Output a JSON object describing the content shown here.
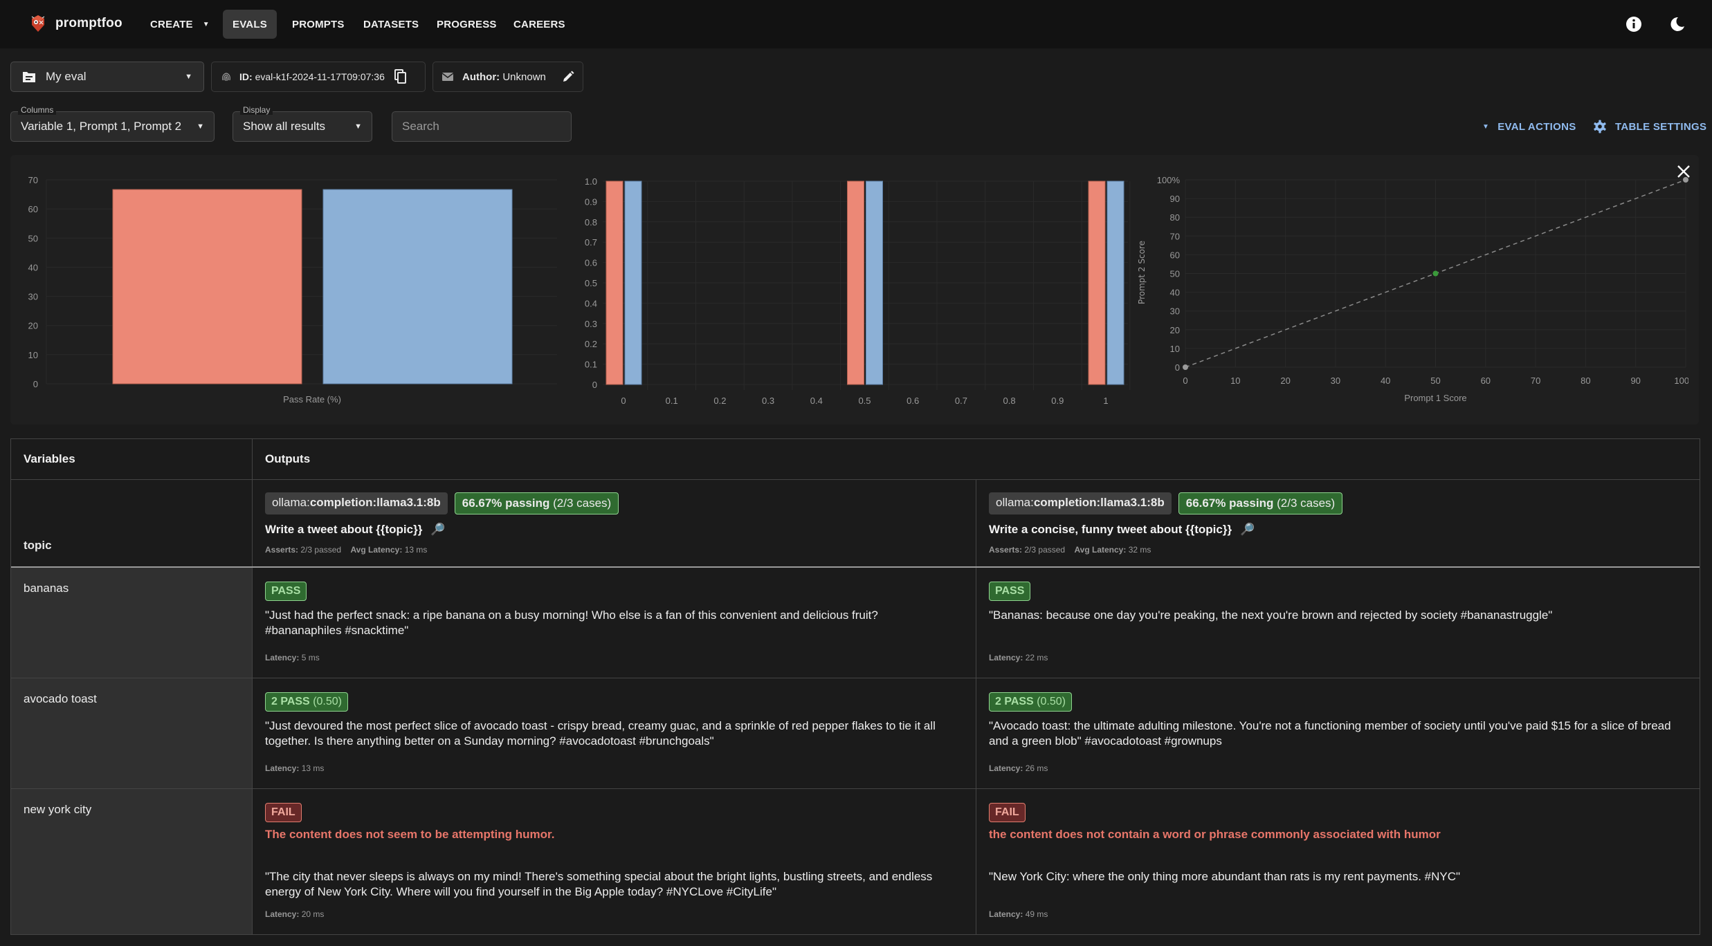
{
  "nav": {
    "brand": "promptfoo",
    "items": [
      {
        "label": "CREATE",
        "has_dropdown": true,
        "active": false
      },
      {
        "label": "EVALS",
        "has_dropdown": false,
        "active": true
      },
      {
        "label": "PROMPTS",
        "has_dropdown": false,
        "active": false
      },
      {
        "label": "DATASETS",
        "has_dropdown": false,
        "active": false
      },
      {
        "label": "PROGRESS",
        "has_dropdown": false,
        "active": false
      },
      {
        "label": "CAREERS",
        "has_dropdown": false,
        "active": false
      }
    ],
    "right_icons": [
      "info-icon",
      "moon-icon"
    ]
  },
  "toolbar": {
    "eval_name": "My eval",
    "id_label": "ID:",
    "id_value": "eval-k1f-2024-11-17T09:07:36",
    "author_label": "Author:",
    "author_value": "Unknown",
    "columns_legend": "Columns",
    "columns_value": "Variable 1, Prompt 1, Prompt 2",
    "display_legend": "Display",
    "display_value": "Show all results",
    "search_placeholder": "Search",
    "search_value": "",
    "eval_actions_label": "EVAL ACTIONS",
    "table_settings_label": "TABLE SETTINGS"
  },
  "colors": {
    "prompt1": "#ec8876",
    "prompt2": "#8cb0d6",
    "accent": "#90bbef",
    "pass": "#2f6a30",
    "fail": "#672828",
    "fail_text": "#e8766a"
  },
  "chart_data": [
    {
      "type": "bar",
      "title": "",
      "xlabel": "Pass Rate (%)",
      "ylabel": "",
      "categories": [
        "Pass Rate (%)"
      ],
      "series": [
        {
          "name": "Prompt 1",
          "values": [
            66.67
          ]
        },
        {
          "name": "Prompt 2",
          "values": [
            66.67
          ]
        }
      ],
      "ylim": [
        0,
        70
      ],
      "yticks": [
        0,
        10,
        20,
        30,
        40,
        50,
        60,
        70
      ],
      "grid": true
    },
    {
      "type": "bar",
      "title": "",
      "xlabel": "",
      "ylabel": "",
      "x": [
        0,
        0.5,
        1
      ],
      "series": [
        {
          "name": "Prompt 1",
          "values": [
            1,
            1,
            1
          ]
        },
        {
          "name": "Prompt 2",
          "values": [
            1,
            1,
            1
          ]
        }
      ],
      "xlim": [
        0,
        1
      ],
      "xticks": [
        "0",
        "0.1",
        "0.2",
        "0.3",
        "0.4",
        "0.5",
        "0.6",
        "0.7",
        "0.8",
        "0.9",
        "1"
      ],
      "ylim": [
        0,
        1
      ],
      "yticks": [
        "0",
        "0.1",
        "0.2",
        "0.3",
        "0.4",
        "0.5",
        "0.6",
        "0.7",
        "0.8",
        "0.9",
        "1.0"
      ],
      "grid": true
    },
    {
      "type": "scatter",
      "title": "",
      "xlabel": "Prompt 1 Score",
      "ylabel": "Prompt 2 Score",
      "points": [
        {
          "x": 0,
          "y": 0,
          "color": "#9a9a9a"
        },
        {
          "x": 50,
          "y": 50,
          "color": "#3a9a3a"
        },
        {
          "x": 100,
          "y": 100,
          "color": "#9a9a9a"
        }
      ],
      "reference_line": {
        "from": [
          0,
          0
        ],
        "to": [
          100,
          100
        ],
        "style": "dashed"
      },
      "xlim": [
        0,
        100
      ],
      "ylim": [
        0,
        100
      ],
      "xticks": [
        "0",
        "10",
        "20",
        "30",
        "40",
        "50",
        "60",
        "70",
        "80",
        "90",
        "100%"
      ],
      "yticks": [
        "0",
        "10",
        "20",
        "30",
        "40",
        "50",
        "60",
        "70",
        "80",
        "90",
        "100%"
      ],
      "grid": true
    }
  ],
  "table": {
    "headers": {
      "variables": "Variables",
      "outputs": "Outputs"
    },
    "variable_name": "topic",
    "prompts": [
      {
        "provider_prefix": "ollama:",
        "provider_name": "completion:llama3.1:8b",
        "pass_pct": "66.67% passing",
        "pass_cases": "(2/3 cases)",
        "text": "Write a tweet about {{topic}}",
        "asserts_label": "Asserts:",
        "asserts_value": "2/3 passed",
        "latency_label": "Avg Latency:",
        "latency_value": "13 ms"
      },
      {
        "provider_prefix": "ollama:",
        "provider_name": "completion:llama3.1:8b",
        "pass_pct": "66.67% passing",
        "pass_cases": "(2/3 cases)",
        "text": "Write a concise, funny tweet about {{topic}}",
        "asserts_label": "Asserts:",
        "asserts_value": "2/3 passed",
        "latency_label": "Avg Latency:",
        "latency_value": "32 ms"
      }
    ],
    "latency_label": "Latency:",
    "rows": [
      {
        "topic": "bananas",
        "outputs": [
          {
            "status": "pass",
            "badge": "PASS",
            "score": "",
            "reason": "",
            "text": "\"Just had the perfect snack: a ripe banana on a busy morning! Who else is a fan of this convenient and delicious fruit? #bananaphiles #snacktime\"",
            "latency": "5 ms"
          },
          {
            "status": "pass",
            "badge": "PASS",
            "score": "",
            "reason": "",
            "text": "\"Bananas: because one day you're peaking, the next you're brown and rejected by society #bananastruggle\"",
            "latency": "22 ms"
          }
        ]
      },
      {
        "topic": "avocado toast",
        "outputs": [
          {
            "status": "pass",
            "badge": "2 PASS",
            "score": "(0.50)",
            "reason": "",
            "text": "\"Just devoured the most perfect slice of avocado toast - crispy bread, creamy guac, and a sprinkle of red pepper flakes to tie it all together. Is there anything better on a Sunday morning? #avocadotoast #brunchgoals\"",
            "latency": "13 ms"
          },
          {
            "status": "pass",
            "badge": "2 PASS",
            "score": "(0.50)",
            "reason": "",
            "text": "\"Avocado toast: the ultimate adulting milestone. You're not a functioning member of society until you've paid $15 for a slice of bread and a green blob\" #avocadotoast #grownups",
            "latency": "26 ms"
          }
        ]
      },
      {
        "topic": "new york city",
        "outputs": [
          {
            "status": "fail",
            "badge": "FAIL",
            "score": "",
            "reason": "The content does not seem to be attempting humor.",
            "text": "\"The city that never sleeps is always on my mind! There's something special about the bright lights, bustling streets, and endless energy of New York City. Where will you find yourself in the Big Apple today? #NYCLove #CityLife\"",
            "latency": "20 ms"
          },
          {
            "status": "fail",
            "badge": "FAIL",
            "score": "",
            "reason": "the content does not contain a word or phrase commonly associated with humor",
            "text": "\"New York City: where the only thing more abundant than rats is my rent payments. #NYC\"",
            "latency": "49 ms"
          }
        ]
      }
    ]
  }
}
